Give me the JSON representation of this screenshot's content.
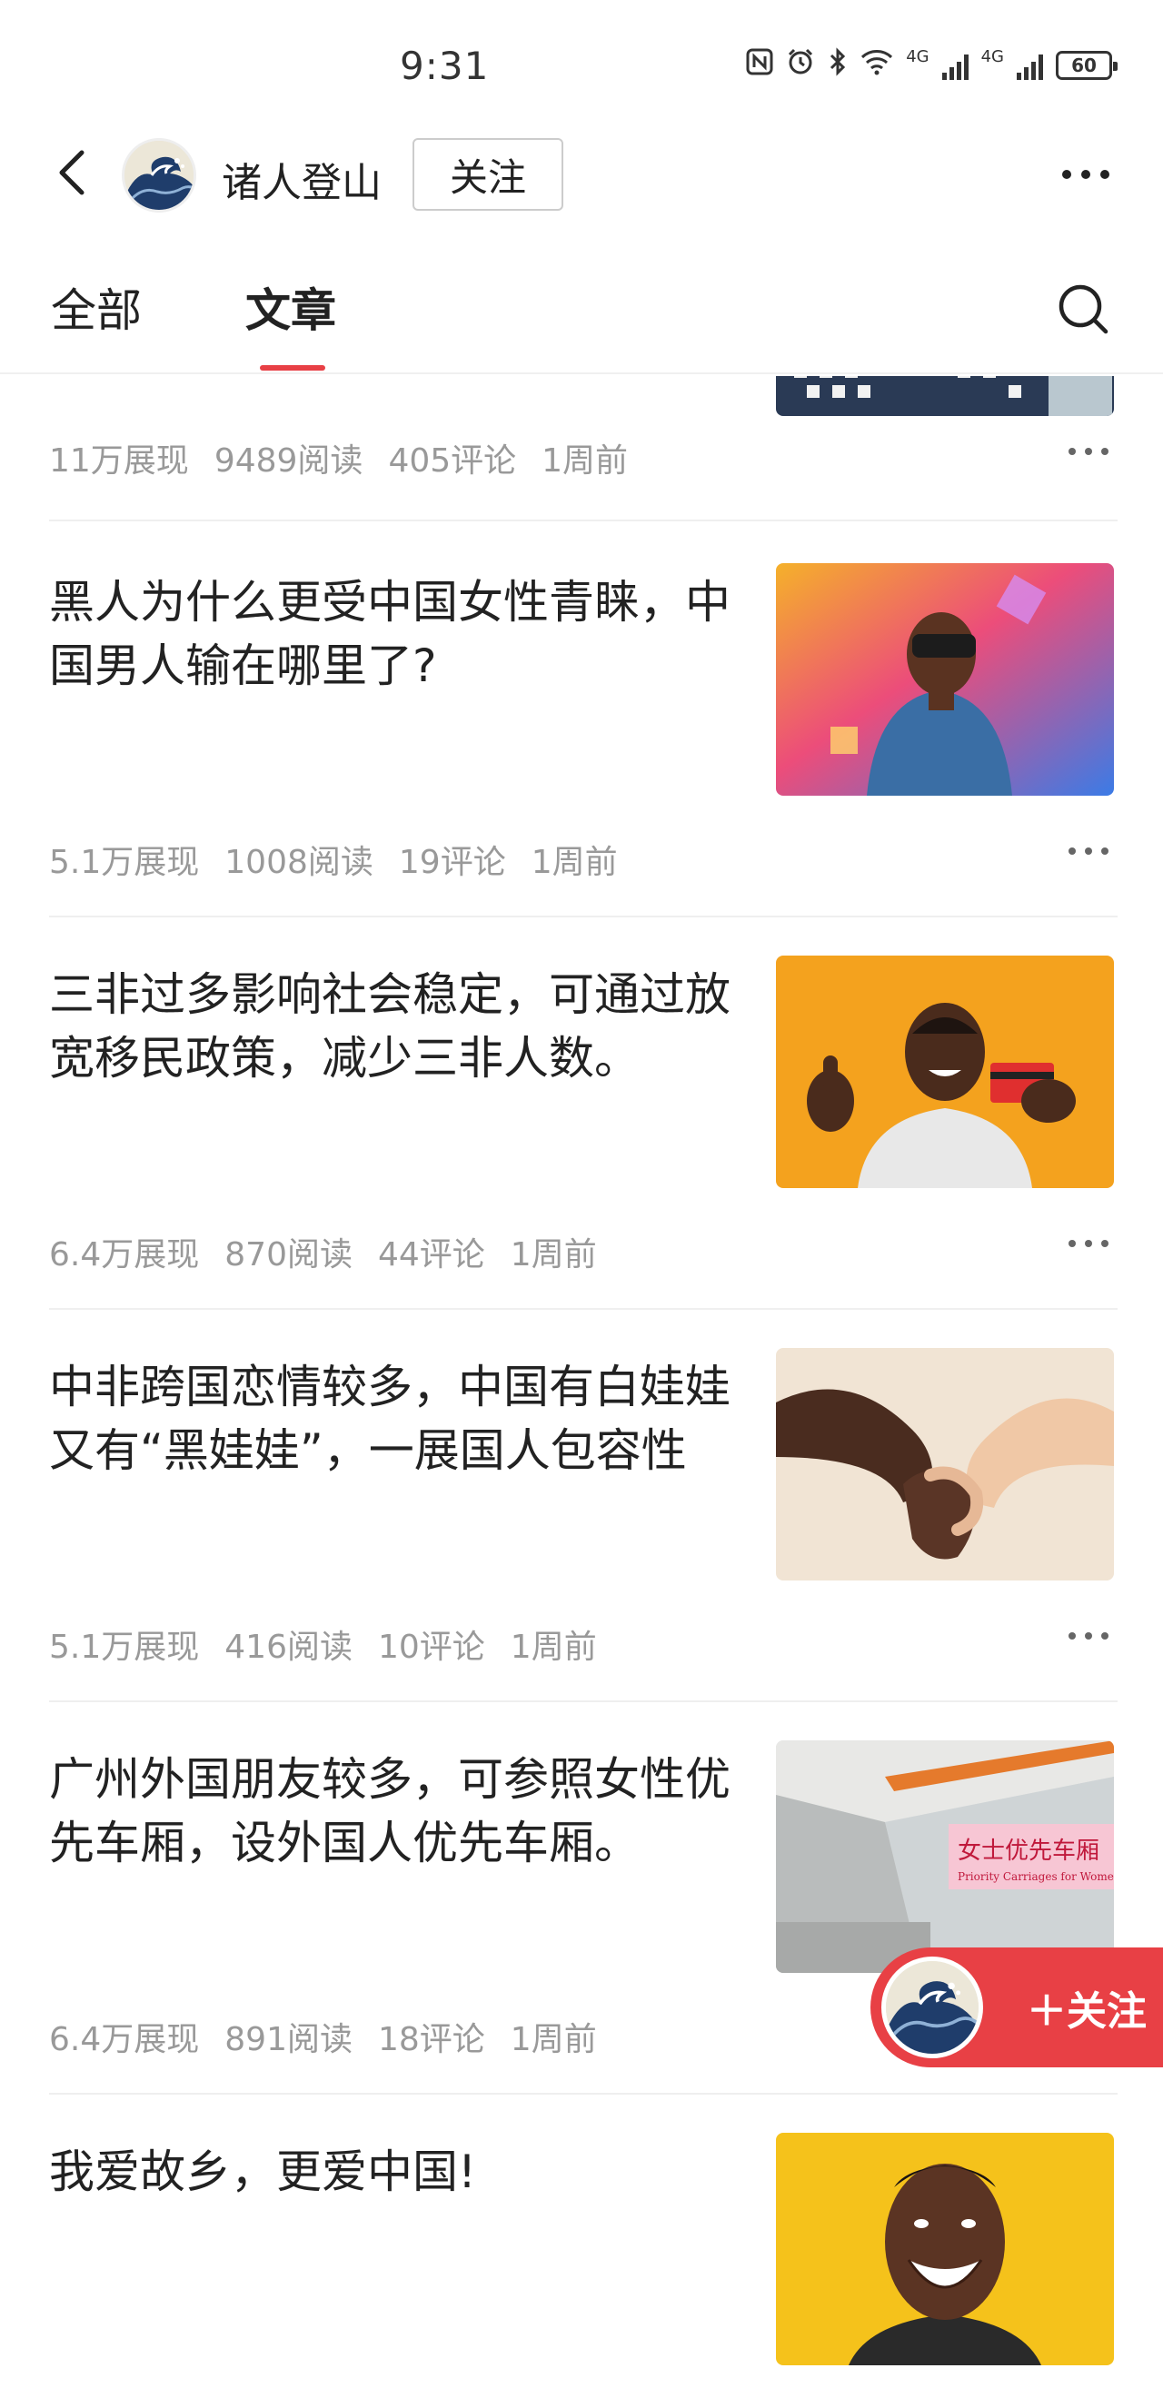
{
  "status_bar": {
    "time": "9:31",
    "network_1": "4G",
    "network_2": "4G",
    "battery": "60",
    "icons": [
      "nfc-icon",
      "alarm-icon",
      "bluetooth-icon",
      "wifi-icon",
      "signal-icon",
      "signal-icon",
      "battery-icon"
    ]
  },
  "header": {
    "author_name": "诸人登山",
    "follow_label": "关注",
    "back_icon": "chevron-left-icon",
    "more_icon": "more-horizontal-icon"
  },
  "tabs": {
    "items": [
      {
        "label": "全部",
        "active": false
      },
      {
        "label": "文章",
        "active": true
      }
    ],
    "search_icon": "search-icon"
  },
  "articles": [
    {
      "title": "",
      "impressions": "11万展现",
      "reads": "9489阅读",
      "comments": "405评论",
      "time": "1周前"
    },
    {
      "title": "黑人为什么更受中国女性青睐，中国男人输在哪里了?",
      "impressions": "5.1万展现",
      "reads": "1008阅读",
      "comments": "19评论",
      "time": "1周前"
    },
    {
      "title": "三非过多影响社会稳定，可通过放宽移民政策，减少三非人数。",
      "impressions": "6.4万展现",
      "reads": "870阅读",
      "comments": "44评论",
      "time": "1周前"
    },
    {
      "title": "中非跨国恋情较多，中国有白娃娃又有“黑娃娃”，一展国人包容性",
      "impressions": "5.1万展现",
      "reads": "416阅读",
      "comments": "10评论",
      "time": "1周前"
    },
    {
      "title": "广州外国朋友较多，可参照女性优先车厢，设外国人优先车厢。",
      "impressions": "6.4万展现",
      "reads": "891阅读",
      "comments": "18评论",
      "time": "1周前",
      "image_sign_main": "女士优先车厢",
      "image_sign_sub": "Priority Carriages for Women"
    },
    {
      "title": "我爱故乡，更爱中国!",
      "impressions": "",
      "reads": "",
      "comments": "",
      "time": ""
    }
  ],
  "floating_follow": {
    "label": "＋关注"
  },
  "colors": {
    "accent": "#e84045",
    "meta_text": "#999999",
    "title_text": "#222222"
  }
}
